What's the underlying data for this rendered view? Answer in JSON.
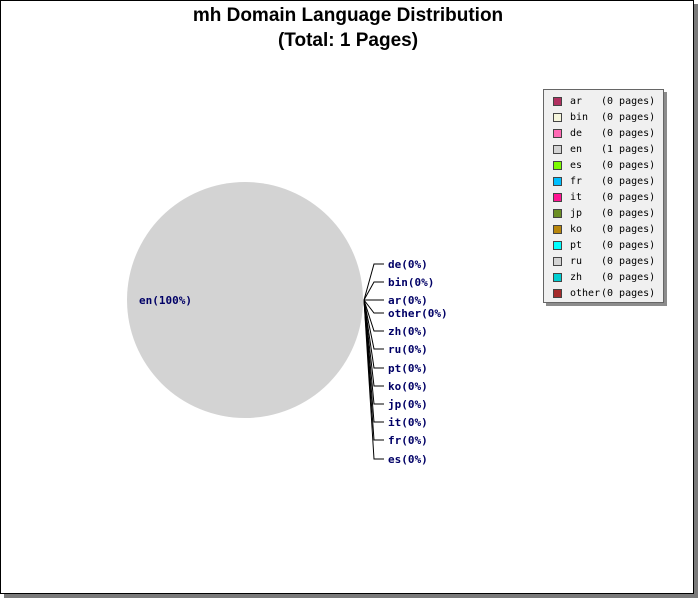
{
  "chart_data": {
    "type": "pie",
    "title": "mh Domain Language Distribution",
    "subtitle": "(Total: 1 Pages)",
    "categories": [
      "ar",
      "bin",
      "de",
      "en",
      "es",
      "fr",
      "it",
      "jp",
      "ko",
      "pt",
      "ru",
      "zh",
      "other"
    ],
    "values": [
      0,
      0,
      0,
      1,
      0,
      0,
      0,
      0,
      0,
      0,
      0,
      0,
      0
    ],
    "colors": [
      "#b03060",
      "#f5f5dc",
      "#ff69b4",
      "#d3d3d3",
      "#7cfc00",
      "#00bfff",
      "#ff1493",
      "#6b8e23",
      "#b8860b",
      "#00ffff",
      "#d3d3d3",
      "#00ced1",
      "#a52a2a"
    ],
    "slice_labels": [
      {
        "key": "en",
        "text": "en(100%)"
      },
      {
        "key": "de",
        "text": "de(0%)"
      },
      {
        "key": "bin",
        "text": "bin(0%)"
      },
      {
        "key": "ar",
        "text": "ar(0%)"
      },
      {
        "key": "other",
        "text": "other(0%)"
      },
      {
        "key": "zh",
        "text": "zh(0%)"
      },
      {
        "key": "ru",
        "text": "ru(0%)"
      },
      {
        "key": "pt",
        "text": "pt(0%)"
      },
      {
        "key": "ko",
        "text": "ko(0%)"
      },
      {
        "key": "jp",
        "text": "jp(0%)"
      },
      {
        "key": "it",
        "text": "it(0%)"
      },
      {
        "key": "fr",
        "text": "fr(0%)"
      },
      {
        "key": "es",
        "text": "es(0%)"
      }
    ],
    "legend_placement": "top-right",
    "legend": [
      {
        "name": "ar",
        "count": "(0 pages)",
        "color": "#b03060"
      },
      {
        "name": "bin",
        "count": "(0 pages)",
        "color": "#f5f5dc"
      },
      {
        "name": "de",
        "count": "(0 pages)",
        "color": "#ff69b4"
      },
      {
        "name": "en",
        "count": "(1 pages)",
        "color": "#d3d3d3"
      },
      {
        "name": "es",
        "count": "(0 pages)",
        "color": "#7cfc00"
      },
      {
        "name": "fr",
        "count": "(0 pages)",
        "color": "#00bfff"
      },
      {
        "name": "it",
        "count": "(0 pages)",
        "color": "#ff1493"
      },
      {
        "name": "jp",
        "count": "(0 pages)",
        "color": "#6b8e23"
      },
      {
        "name": "ko",
        "count": "(0 pages)",
        "color": "#b8860b"
      },
      {
        "name": "pt",
        "count": "(0 pages)",
        "color": "#00ffff"
      },
      {
        "name": "ru",
        "count": "(0 pages)",
        "color": "#d3d3d3"
      },
      {
        "name": "zh",
        "count": "(0 pages)",
        "color": "#00ced1"
      },
      {
        "name": "other",
        "count": "(0 pages)",
        "color": "#a52a2a"
      }
    ]
  }
}
